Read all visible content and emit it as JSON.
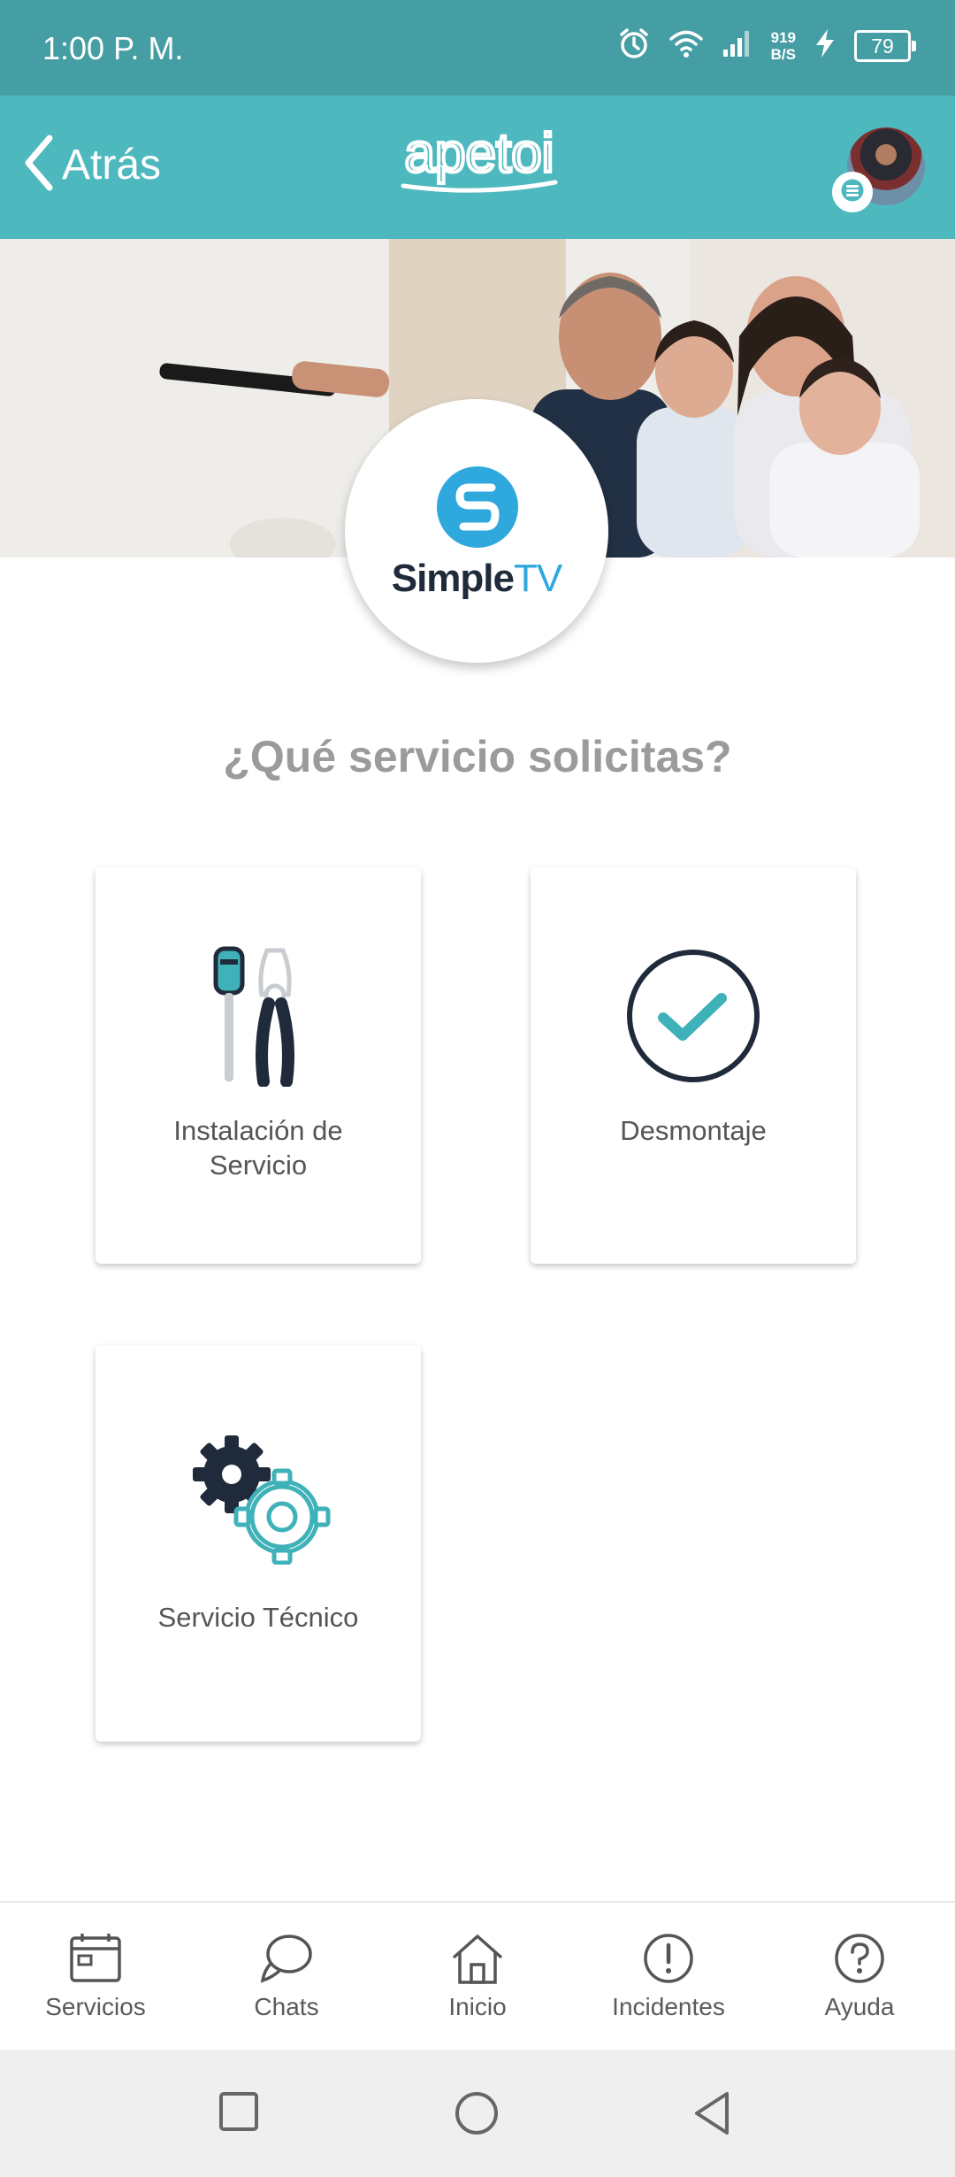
{
  "status_bar": {
    "time": "1:00 P. M.",
    "net_speed_value": "919",
    "net_speed_unit": "B/S",
    "battery_level": "79",
    "icons": [
      "alarm-icon",
      "wifi-icon",
      "signal-icon",
      "charging-icon",
      "battery-icon"
    ]
  },
  "header": {
    "back_label": "Atrás",
    "logo_text": "apetoi",
    "avatar": "avatar",
    "menu_icon": "menu-icon"
  },
  "brand": {
    "name_part1": "Simple",
    "name_part2": "TV"
  },
  "main": {
    "question": "¿Qué servicio solicitas?",
    "services": [
      {
        "line1": "Instalación de",
        "line2": "Servicio",
        "icon": "tools-icon"
      },
      {
        "label": "Desmontaje",
        "icon": "check-circle-icon"
      },
      {
        "label": "Servicio Técnico",
        "icon": "gears-icon"
      }
    ]
  },
  "bottom_nav": {
    "items": [
      {
        "label": "Servicios",
        "icon": "calendar-icon"
      },
      {
        "label": "Chats",
        "icon": "chat-icon"
      },
      {
        "label": "Inicio",
        "icon": "home-icon"
      },
      {
        "label": "Incidentes",
        "icon": "alert-icon"
      },
      {
        "label": "Ayuda",
        "icon": "help-icon"
      }
    ]
  },
  "colors": {
    "status_bar": "#459ea3",
    "header": "#4eb8bf",
    "accent": "#3fb2b9",
    "dark_icon": "#1f2a3a",
    "brand_blue": "#2ea8dd"
  }
}
